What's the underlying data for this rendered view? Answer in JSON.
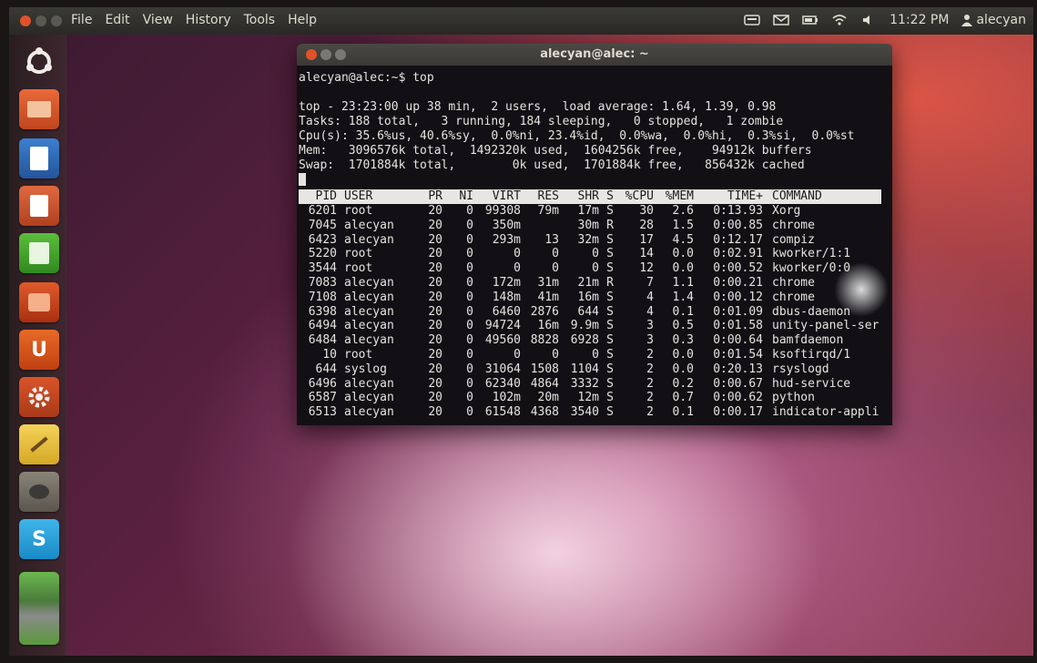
{
  "top_panel": {
    "menu": [
      "File",
      "Edit",
      "View",
      "History",
      "Tools",
      "Help"
    ],
    "clock": "11:22 PM",
    "user": "alecyan"
  },
  "launcher": {
    "icons": [
      "ubuntu-dash-icon",
      "files-icon",
      "writer-icon",
      "impress-icon",
      "calc-icon",
      "software-center-icon",
      "ubuntu-one-icon",
      "settings-icon",
      "text-editor-icon",
      "gimp-icon",
      "skype-icon",
      "stacked-apps-icon"
    ],
    "ubuntu_one_letter": "U",
    "skype_letter": "S"
  },
  "terminal": {
    "title": "alecyan@alec: ~",
    "prompt": "alecyan@alec:~$ top",
    "summary": [
      "top - 23:23:00 up 38 min,  2 users,  load average: 1.64, 1.39, 0.98",
      "Tasks: 188 total,   3 running, 184 sleeping,   0 stopped,   1 zombie",
      "Cpu(s): 35.6%us, 40.6%sy,  0.0%ni, 23.4%id,  0.0%wa,  0.0%hi,  0.3%si,  0.0%st",
      "Mem:   3096576k total,  1492320k used,  1604256k free,    94912k buffers",
      "Swap:  1701884k total,        0k used,  1701884k free,   856432k cached"
    ],
    "columns": [
      "PID",
      "USER",
      "PR",
      "NI",
      "VIRT",
      "RES",
      "SHR",
      "S",
      "%CPU",
      "%MEM",
      "TIME+",
      "COMMAND"
    ],
    "processes": [
      [
        "6201",
        "root",
        "20",
        "0",
        "99308",
        "79m",
        "17m",
        "S",
        "30",
        "2.6",
        "0:13.93",
        "Xorg"
      ],
      [
        "7045",
        "alecyan",
        "20",
        "0",
        "350m",
        "",
        "30m",
        "R",
        "28",
        "1.5",
        "0:00.85",
        "chrome"
      ],
      [
        "6423",
        "alecyan",
        "20",
        "0",
        "293m",
        "13",
        "32m",
        "S",
        "17",
        "4.5",
        "0:12.17",
        "compiz"
      ],
      [
        "5220",
        "root",
        "20",
        "0",
        "0",
        "0",
        "0",
        "S",
        "14",
        "0.0",
        "0:02.91",
        "kworker/1:1"
      ],
      [
        "3544",
        "root",
        "20",
        "0",
        "0",
        "0",
        "0",
        "S",
        "12",
        "0.0",
        "0:00.52",
        "kworker/0:0"
      ],
      [
        "7083",
        "alecyan",
        "20",
        "0",
        "172m",
        "31m",
        "21m",
        "R",
        "7",
        "1.1",
        "0:00.21",
        "chrome"
      ],
      [
        "7108",
        "alecyan",
        "20",
        "0",
        "148m",
        "41m",
        "16m",
        "S",
        "4",
        "1.4",
        "0:00.12",
        "chrome"
      ],
      [
        "6398",
        "alecyan",
        "20",
        "0",
        "6460",
        "2876",
        "644",
        "S",
        "4",
        "0.1",
        "0:01.09",
        "dbus-daemon"
      ],
      [
        "6494",
        "alecyan",
        "20",
        "0",
        "94724",
        "16m",
        "9.9m",
        "S",
        "3",
        "0.5",
        "0:01.58",
        "unity-panel-ser"
      ],
      [
        "6484",
        "alecyan",
        "20",
        "0",
        "49560",
        "8828",
        "6928",
        "S",
        "3",
        "0.3",
        "0:00.64",
        "bamfdaemon"
      ],
      [
        "10",
        "root",
        "20",
        "0",
        "0",
        "0",
        "0",
        "S",
        "2",
        "0.0",
        "0:01.54",
        "ksoftirqd/1"
      ],
      [
        "644",
        "syslog",
        "20",
        "0",
        "31064",
        "1508",
        "1104",
        "S",
        "2",
        "0.0",
        "0:20.13",
        "rsyslogd"
      ],
      [
        "6496",
        "alecyan",
        "20",
        "0",
        "62340",
        "4864",
        "3332",
        "S",
        "2",
        "0.2",
        "0:00.67",
        "hud-service"
      ],
      [
        "6587",
        "alecyan",
        "20",
        "0",
        "102m",
        "20m",
        "12m",
        "S",
        "2",
        "0.7",
        "0:00.62",
        "python"
      ],
      [
        "6513",
        "alecyan",
        "20",
        "0",
        "61548",
        "4368",
        "3540",
        "S",
        "2",
        "0.1",
        "0:00.17",
        "indicator-appli"
      ]
    ]
  }
}
